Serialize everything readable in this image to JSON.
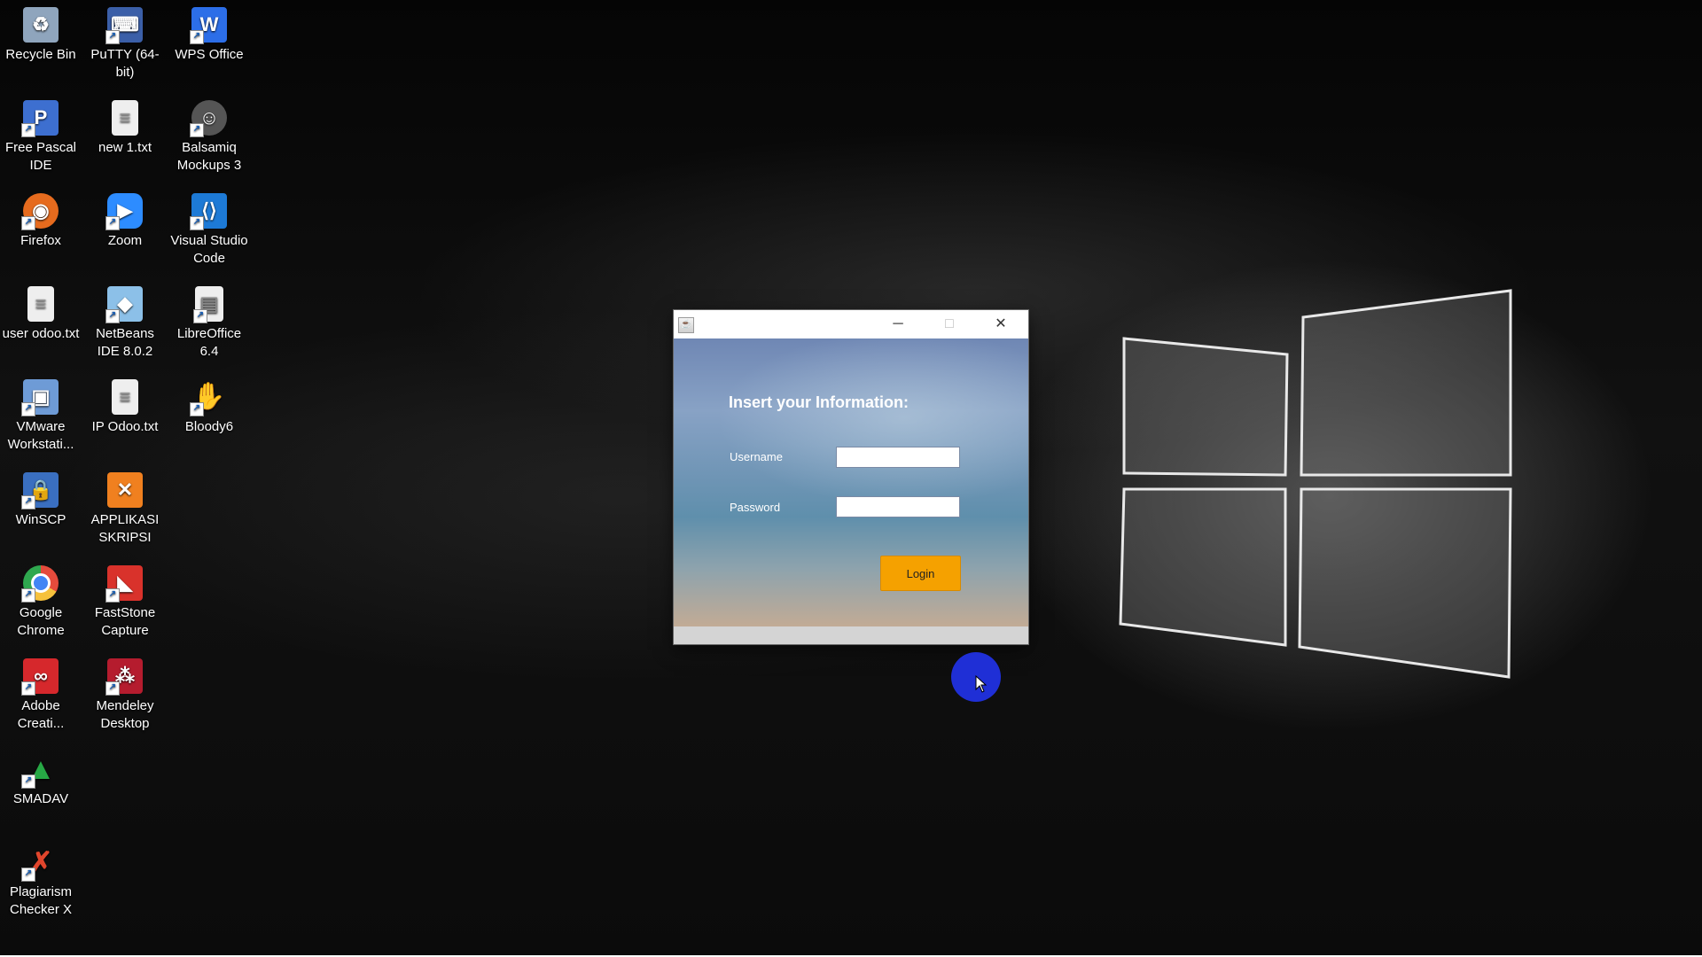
{
  "desktop_icons": [
    {
      "label": "Recycle Bin",
      "icon": "recycle-bin-icon",
      "color": "#9ab0c8"
    },
    {
      "label": "PuTTY (64-bit)",
      "icon": "putty-icon",
      "color": "#3b5fa8"
    },
    {
      "label": "WPS Office",
      "icon": "wps-office-icon",
      "color": "#2c6ee8"
    },
    {
      "label": "Free Pascal IDE",
      "icon": "free-pascal-icon",
      "color": "#3d6fd0"
    },
    {
      "label": "new 1.txt",
      "icon": "text-file-icon",
      "color": "#e8e8e8"
    },
    {
      "label": "Balsamiq Mockups 3",
      "icon": "balsamiq-icon",
      "color": "#444444"
    },
    {
      "label": "Firefox",
      "icon": "firefox-icon",
      "color": "#e66b1e"
    },
    {
      "label": "Zoom",
      "icon": "zoom-icon",
      "color": "#2d8cff"
    },
    {
      "label": "Visual Studio Code",
      "icon": "vscode-icon",
      "color": "#1d7ad6"
    },
    {
      "label": "user odoo.txt",
      "icon": "text-file-icon",
      "color": "#e8e8e8"
    },
    {
      "label": "NetBeans IDE 8.0.2",
      "icon": "netbeans-icon",
      "color": "#8cc0e8"
    },
    {
      "label": "LibreOffice 6.4",
      "icon": "libreoffice-icon",
      "color": "#e8e8e8"
    },
    {
      "label": "VMware Workstati...",
      "icon": "vmware-icon",
      "color": "#6e9bd6"
    },
    {
      "label": "IP Odoo.txt",
      "icon": "text-file-icon",
      "color": "#e8e8e8"
    },
    {
      "label": "Bloody6",
      "icon": "bloody-icon",
      "color": "#c41a1a"
    },
    {
      "label": "WinSCP",
      "icon": "winscp-icon",
      "color": "#3a6fc0"
    },
    {
      "label": "APPLIKASI SKRIPSI",
      "icon": "xampp-icon",
      "color": "#f0801f"
    },
    {
      "label": "Google Chrome",
      "icon": "chrome-icon",
      "color": "#e54b3c"
    },
    {
      "label": "FastStone Capture",
      "icon": "faststone-icon",
      "color": "#d9322b"
    },
    {
      "label": "Adobe Creati...",
      "icon": "adobe-cc-icon",
      "color": "#d6282c"
    },
    {
      "label": "Mendeley Desktop",
      "icon": "mendeley-icon",
      "color": "#b51c2e"
    },
    {
      "label": "SMADAV",
      "icon": "smadav-icon",
      "color": "#27a845"
    },
    {
      "label": "Plagiarism Checker X",
      "icon": "plagiarism-checker-icon",
      "color": "#e0452c"
    }
  ],
  "window": {
    "title": "",
    "minimize": "─",
    "maximize": "□",
    "close": "✕"
  },
  "form": {
    "heading": "Insert your Information:",
    "username_label": "Username",
    "username_value": "",
    "password_label": "Password",
    "password_value": "",
    "login_label": "Login"
  },
  "colors": {
    "login_button": "#f5a100",
    "cursor_highlight": "#1f2fd6"
  }
}
